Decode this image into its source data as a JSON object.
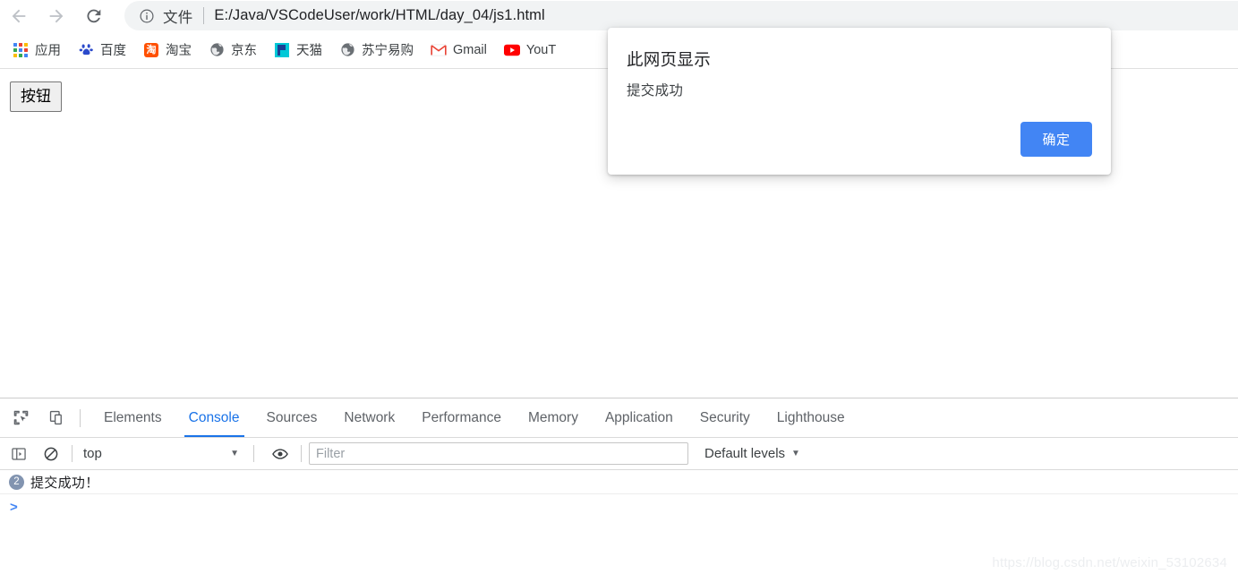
{
  "browser": {
    "nav": {
      "back_title": "Back",
      "forward_title": "Forward",
      "reload_title": "Reload"
    },
    "omnibox": {
      "scheme_label": "文件",
      "url": "E:/Java/VSCodeUser/work/HTML/day_04/js1.html",
      "info_icon": "info-circle-icon"
    },
    "bookmarks": [
      {
        "label": "应用",
        "icon": "apps-grid-icon"
      },
      {
        "label": "百度",
        "icon": "baidu-paw-icon"
      },
      {
        "label": "淘宝",
        "icon": "taobao-icon"
      },
      {
        "label": "京东",
        "icon": "globe-icon"
      },
      {
        "label": "天猫",
        "icon": "tmall-icon"
      },
      {
        "label": "苏宁易购",
        "icon": "globe-icon"
      },
      {
        "label": "Gmail",
        "icon": "gmail-icon"
      },
      {
        "label": "YouT",
        "icon": "youtube-icon"
      }
    ]
  },
  "page": {
    "button_label": "按钮"
  },
  "dialog": {
    "title": "此网页显示",
    "message": "提交成功",
    "ok_label": "确定",
    "accent_color": "#4285f4"
  },
  "devtools": {
    "tabs": [
      {
        "label": "Elements",
        "active": false
      },
      {
        "label": "Console",
        "active": true
      },
      {
        "label": "Sources",
        "active": false
      },
      {
        "label": "Network",
        "active": false
      },
      {
        "label": "Performance",
        "active": false
      },
      {
        "label": "Memory",
        "active": false
      },
      {
        "label": "Application",
        "active": false
      },
      {
        "label": "Security",
        "active": false
      },
      {
        "label": "Lighthouse",
        "active": false
      }
    ],
    "icons": {
      "inspect": "inspect-element-icon",
      "device": "device-toolbar-icon",
      "sidebar": "console-sidebar-icon",
      "clear": "clear-console-icon",
      "eye": "eye-icon"
    },
    "console_toolbar": {
      "context": "top",
      "context_caret": "▼",
      "filter_placeholder": "Filter",
      "filter_value": "",
      "levels_label": "Default levels",
      "levels_caret": "▼"
    },
    "messages": [
      {
        "count": "2",
        "text": "提交成功！"
      }
    ],
    "prompt": ">",
    "active_tab_color": "#1a73e8"
  },
  "watermark": "https://blog.csdn.net/weixin_53102634"
}
